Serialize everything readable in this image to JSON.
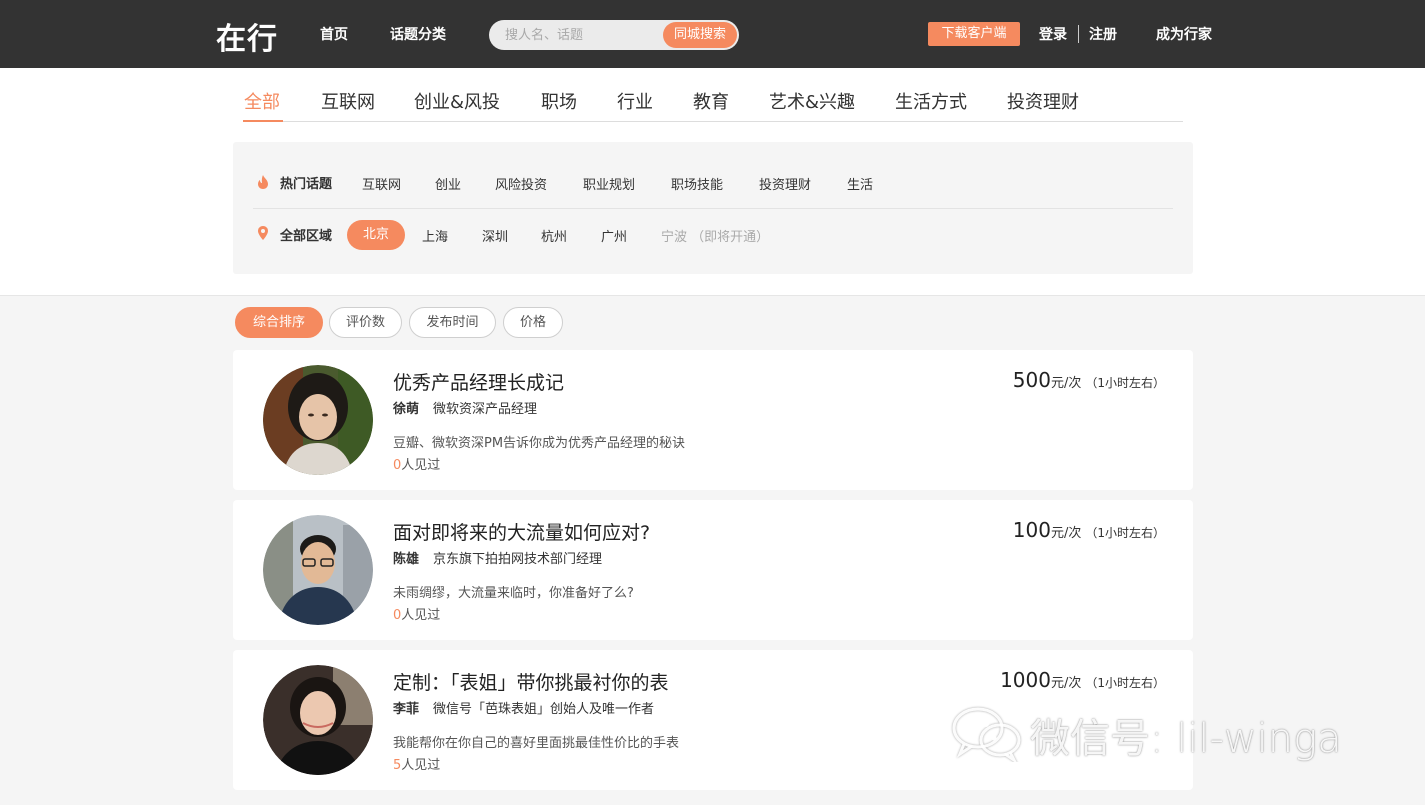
{
  "header": {
    "logo": "在行",
    "nav": [
      "首页",
      "话题分类"
    ],
    "search_placeholder": "搜人名、话题",
    "search_button": "同城搜索",
    "download_button": "下载客户端",
    "login": "登录",
    "register": "注册",
    "become_expert": "成为行家"
  },
  "categories": {
    "items": [
      "全部",
      "互联网",
      "创业&风投",
      "职场",
      "行业",
      "教育",
      "艺术&兴趣",
      "生活方式",
      "投资理财"
    ],
    "active": "全部"
  },
  "filters": {
    "hot_topics": {
      "label": "热门话题",
      "icon": "flame-icon",
      "items": [
        "互联网",
        "创业",
        "风险投资",
        "职业规划",
        "职场技能",
        "投资理财",
        "生活"
      ]
    },
    "regions": {
      "label": "全部区域",
      "icon": "location-pin-icon",
      "items": [
        "北京",
        "上海",
        "深圳",
        "杭州",
        "广州",
        "宁波 （即将开通）"
      ],
      "active": "北京",
      "disabled": "宁波 （即将开通）"
    }
  },
  "sort": {
    "items": [
      "综合排序",
      "评价数",
      "发布时间",
      "价格"
    ],
    "active": "综合排序"
  },
  "experts": [
    {
      "title": "优秀产品经理长成记",
      "name": "徐萌",
      "role": "微软资深产品经理",
      "desc": "豆瓣、微软资深PM告诉你成为优秀产品经理的秘诀",
      "met_count": "0",
      "met_suffix": "人见过",
      "price": "500",
      "price_unit": "元/次",
      "duration": "（1小时左右）"
    },
    {
      "title": "面对即将来的大流量如何应对?",
      "name": "陈雄",
      "role": "京东旗下拍拍网技术部门经理",
      "desc": "未雨绸缪，大流量来临时，你准备好了么?",
      "met_count": "0",
      "met_suffix": "人见过",
      "price": "100",
      "price_unit": "元/次",
      "duration": "（1小时左右）"
    },
    {
      "title": "定制：「表姐」带你挑最衬你的表",
      "name": "李菲",
      "role": "微信号「芭珠表姐」创始人及唯一作者",
      "desc": "我能帮你在你自己的喜好里面挑最佳性价比的手表",
      "met_count": "5",
      "met_suffix": "人见过",
      "price": "1000",
      "price_unit": "元/次",
      "duration": "（1小时左右）"
    }
  ],
  "watermark": {
    "text": "微信号: lil-winga",
    "icon": "wechat-icon"
  },
  "colors": {
    "accent": "#f58a5f",
    "topbar": "#333333",
    "background": "#f5f5f5"
  }
}
